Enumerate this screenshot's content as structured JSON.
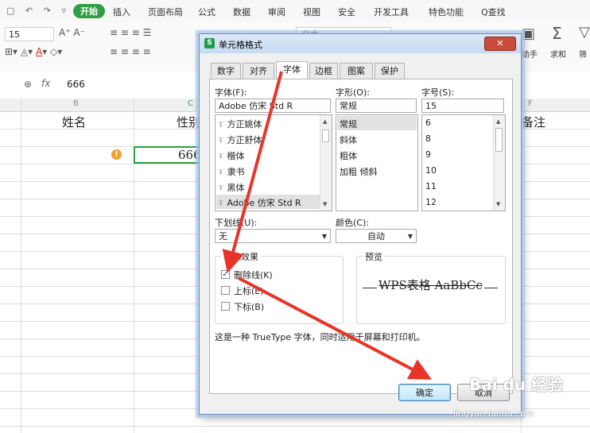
{
  "menu": {
    "quick_icons": "▢ ↶ ↷ ▿",
    "tabs": [
      "开始",
      "插入",
      "页面布局",
      "公式",
      "数据",
      "审阅",
      "视图",
      "安全",
      "开发工具",
      "特色功能",
      "Q查找"
    ]
  },
  "ribbon": {
    "font_size": "15",
    "style_box": "文本",
    "labels": [
      "助手",
      "求和",
      "筛"
    ]
  },
  "formula_bar": {
    "value": "666",
    "fx": "fx"
  },
  "sheet": {
    "columns": [
      "B",
      "C",
      "F"
    ],
    "header_cells": {
      "b": "姓名",
      "c": "性别",
      "f": "备注"
    },
    "active_cell": "666"
  },
  "dialog": {
    "title": "单元格格式",
    "tabs": [
      "数字",
      "对齐",
      "字体",
      "边框",
      "图案",
      "保护"
    ],
    "font_label": "字体(F):",
    "font_value": "Adobe 仿宋 Std R",
    "font_list": [
      "方正姚体",
      "方正舒体",
      "楷体",
      "隶书",
      "黑体",
      "Adobe 仿宋 Std R"
    ],
    "style_label": "字形(O):",
    "style_value": "常规",
    "style_list": [
      "常规",
      "斜体",
      "粗体",
      "加粗 倾斜"
    ],
    "size_label": "字号(S):",
    "size_value": "15",
    "size_list": [
      "6",
      "8",
      "9",
      "10",
      "11",
      "12"
    ],
    "underline_label": "下划线(U):",
    "underline_value": "无",
    "color_label": "颜色(C):",
    "color_value": "自动",
    "effects_label": "特殊效果",
    "strikethrough": "删除线(K)",
    "superscript": "上标(E)",
    "subscript": "下标(B)",
    "preview_label": "预览",
    "preview_text": "WPS表格 AaBbCc",
    "note": "这是一种 TrueType 字体，同时适用于屏幕和打印机。",
    "ok": "确定",
    "cancel": "取消"
  },
  "watermark": {
    "brand": "Bai du 经验",
    "url": "jingyan.baidu.com"
  },
  "colors": {
    "accent_green": "#2ea043",
    "arrow_red": "#e8352a"
  }
}
